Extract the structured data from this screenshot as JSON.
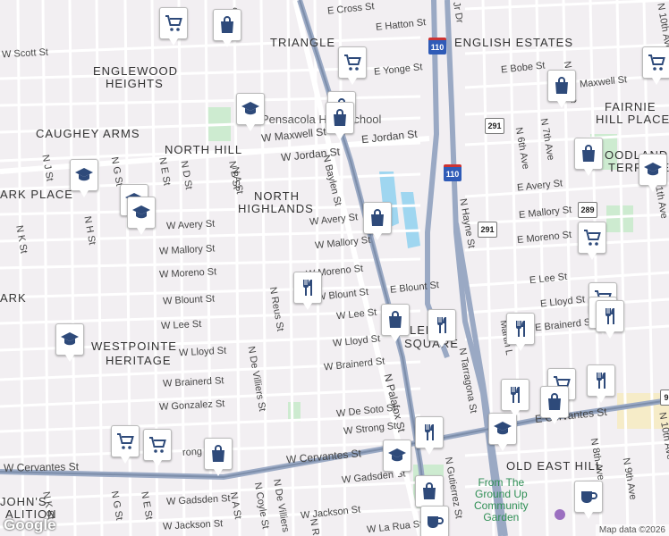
{
  "neighborhoods": [
    {
      "key": "triangle",
      "text": "TRIANGLE"
    },
    {
      "key": "english_estates",
      "text": "ENGLISH ESTATES"
    },
    {
      "key": "englewood_1",
      "text": "ENGLEWOOD"
    },
    {
      "key": "englewood_2",
      "text": "HEIGHTS"
    },
    {
      "key": "fairnie_1",
      "text": "FAIRNIE"
    },
    {
      "key": "fairnie_2",
      "text": "HILL PLACE"
    },
    {
      "key": "caughey",
      "text": "CAUGHEY ARMS"
    },
    {
      "key": "north_hill",
      "text": "NORTH HILL"
    },
    {
      "key": "woodland_1",
      "text": "OODLAND"
    },
    {
      "key": "woodland_2",
      "text": "TERRACE"
    },
    {
      "key": "park_place",
      "text": "ARK PLACE"
    },
    {
      "key": "north_highlands_1",
      "text": "NORTH"
    },
    {
      "key": "north_highlands_2",
      "text": "HIGHLANDS"
    },
    {
      "key": "ark",
      "text": "ARK"
    },
    {
      "key": "westpointe_1",
      "text": "WESTPOINTE"
    },
    {
      "key": "westpointe_2",
      "text": "HERITAGE"
    },
    {
      "key": "lee_square_1",
      "text": "LEE"
    },
    {
      "key": "lee_square_2",
      "text": "SQUARE"
    },
    {
      "key": "old_east_hill",
      "text": "OLD EAST HILL"
    },
    {
      "key": "johns_1",
      "text": "JOHN'S"
    },
    {
      "key": "johns_2",
      "text": "ALITION"
    }
  ],
  "streets": [
    {
      "key": "e_cross",
      "text": "E Cross St"
    },
    {
      "key": "e_hatton",
      "text": "E Hatton St"
    },
    {
      "key": "w_scott",
      "text": "W Scott St"
    },
    {
      "key": "e_yonge",
      "text": "E Yonge St"
    },
    {
      "key": "e_bobe",
      "text": "E Bobe St"
    },
    {
      "key": "maxwell_e",
      "text": "Maxwell St"
    },
    {
      "key": "w_maxwell",
      "text": "W Maxwell St"
    },
    {
      "key": "e_jordan",
      "text": "E Jordan St"
    },
    {
      "key": "w_jordan",
      "text": "W Jordan St"
    },
    {
      "key": "e_avery",
      "text": "E Avery St"
    },
    {
      "key": "w_avery_c",
      "text": "W Avery St"
    },
    {
      "key": "w_avery_w",
      "text": "W Avery St"
    },
    {
      "key": "e_mallory",
      "text": "E Mallory St"
    },
    {
      "key": "w_mallory_c",
      "text": "W Mallory St"
    },
    {
      "key": "w_mallory_w",
      "text": "W Mallory St"
    },
    {
      "key": "e_moreno",
      "text": "E Moreno St"
    },
    {
      "key": "w_moreno_c",
      "text": "W Moreno St"
    },
    {
      "key": "w_moreno_w",
      "text": "W Moreno St"
    },
    {
      "key": "e_lee",
      "text": "E Lee St"
    },
    {
      "key": "w_lee_c",
      "text": "W Lee St"
    },
    {
      "key": "w_lee_w",
      "text": "W Lee St"
    },
    {
      "key": "e_blount",
      "text": "E Blount St"
    },
    {
      "key": "w_blount_c",
      "text": "W Blount St"
    },
    {
      "key": "w_blount_w",
      "text": "W Blount St"
    },
    {
      "key": "e_lloyd",
      "text": "E Lloyd St"
    },
    {
      "key": "w_lloyd_c",
      "text": "W Lloyd St"
    },
    {
      "key": "w_lloyd_w",
      "text": "W Lloyd St"
    },
    {
      "key": "e_brainerd",
      "text": "E Brainerd St"
    },
    {
      "key": "w_brainerd_c",
      "text": "W Brainerd St"
    },
    {
      "key": "w_brainerd_w",
      "text": "W Brainerd St"
    },
    {
      "key": "w_gonzalez",
      "text": "W Gonzalez St"
    },
    {
      "key": "w_desoto_c",
      "text": "W De Soto St"
    },
    {
      "key": "e_cervantes",
      "text": "E Cervantes St"
    },
    {
      "key": "w_strong_c",
      "text": "W Strong St"
    },
    {
      "key": "w_strong_w",
      "text": "rong St"
    },
    {
      "key": "w_cervantes",
      "text": "W Cervantes St"
    },
    {
      "key": "w_cervantes_w",
      "text": "W Cervantes St"
    },
    {
      "key": "w_gadsden_c",
      "text": "W Gadsden St"
    },
    {
      "key": "w_gadsden_w",
      "text": "W Gadsden St"
    },
    {
      "key": "w_jackson_c",
      "text": "W Jackson St"
    },
    {
      "key": "w_jackson_w",
      "text": "W Jackson St"
    },
    {
      "key": "w_larua",
      "text": "W La Rua St"
    },
    {
      "key": "n_palafox",
      "text": "N Palafox St"
    },
    {
      "key": "n_baylen",
      "text": "N Baylen St"
    },
    {
      "key": "n_reus",
      "text": "N Reus St"
    },
    {
      "key": "n_devilliers",
      "text": "N De Villiers St"
    },
    {
      "key": "n_devilliers_s",
      "text": "N De Villiers"
    },
    {
      "key": "n_hayne",
      "text": "N Hayne St"
    },
    {
      "key": "n_tarragona",
      "text": "N Tarragona St"
    },
    {
      "key": "n_gutierrez",
      "text": "N Gutierrez St"
    },
    {
      "key": "n_6th",
      "text": "N 6th Ave"
    },
    {
      "key": "n_7th",
      "text": "N 7th Ave"
    },
    {
      "key": "n_8th_n",
      "text": "N 8th Ave"
    },
    {
      "key": "n_8th_s",
      "text": "N 8th Ave"
    },
    {
      "key": "n_9th",
      "text": "N 9th Ave"
    },
    {
      "key": "n_10th",
      "text": "N 10th Ave"
    },
    {
      "key": "n_10th_s",
      "text": "N 10th Ave"
    },
    {
      "key": "n_11th",
      "text": "11th Ave"
    },
    {
      "key": "n_a",
      "text": "N A St"
    },
    {
      "key": "n_b",
      "text": "N B St"
    },
    {
      "key": "n_d",
      "text": "N D St"
    },
    {
      "key": "n_e",
      "text": "N E St"
    },
    {
      "key": "n_e_s",
      "text": "N E St"
    },
    {
      "key": "n_g",
      "text": "N G St"
    },
    {
      "key": "n_g_s",
      "text": "N G St"
    },
    {
      "key": "n_h",
      "text": "N H St"
    },
    {
      "key": "n_j",
      "text": "N J St"
    },
    {
      "key": "n_k",
      "text": "N K St"
    },
    {
      "key": "n_k_s",
      "text": "N K St"
    },
    {
      "key": "n_coyle",
      "text": "N Coyle St"
    },
    {
      "key": "n_a_s",
      "text": "N A St"
    },
    {
      "key": "n_r",
      "text": "N R"
    },
    {
      "key": "mlk",
      "text": "Martin L"
    },
    {
      "key": "jr_dr",
      "text": "Jr Dr"
    },
    {
      "key": "st_top",
      "text": "St"
    }
  ],
  "pois": [
    {
      "key": "school",
      "text": "Pensacola High School"
    }
  ],
  "park": {
    "line1": "From The",
    "line2": "Ground Up",
    "line3": "Community",
    "line4": "Garden"
  },
  "shields": [
    {
      "key": "i110_top",
      "text": "110",
      "type": "i"
    },
    {
      "key": "i110_mid",
      "text": "110",
      "type": "i"
    },
    {
      "key": "r291_top",
      "text": "291",
      "type": "state"
    },
    {
      "key": "r291_mid",
      "text": "291",
      "type": "state"
    },
    {
      "key": "r289",
      "text": "289",
      "type": "state"
    },
    {
      "key": "r9",
      "text": "9",
      "type": "state"
    }
  ],
  "markers": [
    {
      "name": "grocery-marker-1",
      "icon": "cart"
    },
    {
      "name": "grocery-marker-2",
      "icon": "cart"
    },
    {
      "name": "grocery-marker-3",
      "icon": "cart"
    },
    {
      "name": "grocery-marker-4",
      "icon": "cart"
    },
    {
      "name": "grocery-marker-5",
      "icon": "cart"
    },
    {
      "name": "grocery-marker-6",
      "icon": "cart"
    },
    {
      "name": "grocery-marker-7",
      "icon": "cart"
    },
    {
      "name": "grocery-marker-8",
      "icon": "cart"
    },
    {
      "name": "school-marker-1",
      "icon": "school"
    },
    {
      "name": "school-marker-2",
      "icon": "school"
    },
    {
      "name": "school-marker-3",
      "icon": "school"
    },
    {
      "name": "school-marker-4",
      "icon": "school"
    },
    {
      "name": "school-marker-5",
      "icon": "school"
    },
    {
      "name": "school-marker-6",
      "icon": "school"
    },
    {
      "name": "school-marker-7",
      "icon": "school"
    },
    {
      "name": "school-marker-8",
      "icon": "school"
    },
    {
      "name": "shop-marker-1",
      "icon": "bag"
    },
    {
      "name": "shop-marker-2",
      "icon": "bag"
    },
    {
      "name": "shop-marker-3",
      "icon": "bag"
    },
    {
      "name": "shop-marker-4",
      "icon": "bag"
    },
    {
      "name": "shop-marker-5",
      "icon": "bag"
    },
    {
      "name": "shop-marker-6",
      "icon": "bag"
    },
    {
      "name": "shop-marker-7",
      "icon": "bag"
    },
    {
      "name": "shop-marker-8",
      "icon": "bag"
    },
    {
      "name": "shop-marker-9",
      "icon": "bag"
    },
    {
      "name": "shop-marker-10",
      "icon": "bag"
    },
    {
      "name": "restaurant-marker-1",
      "icon": "fork"
    },
    {
      "name": "restaurant-marker-2",
      "icon": "fork"
    },
    {
      "name": "restaurant-marker-3",
      "icon": "fork"
    },
    {
      "name": "restaurant-marker-4",
      "icon": "fork"
    },
    {
      "name": "restaurant-marker-5",
      "icon": "fork"
    },
    {
      "name": "restaurant-marker-6",
      "icon": "fork"
    },
    {
      "name": "restaurant-marker-7",
      "icon": "fork"
    },
    {
      "name": "restaurant-marker-8",
      "icon": "fork"
    },
    {
      "name": "cafe-marker-1",
      "icon": "cup"
    },
    {
      "name": "cafe-marker-2",
      "icon": "cup"
    }
  ],
  "attribution": "Map data ©2026",
  "logo": "Google",
  "colors": {
    "background": "#f2eff2",
    "highway": "#9aa9c4",
    "arterial": "#ffffff",
    "park": "#cdebd0",
    "water": "#9fd6f0",
    "interstate_shield": "#2f5bb7",
    "marker_icon": "#2e4a7a"
  }
}
